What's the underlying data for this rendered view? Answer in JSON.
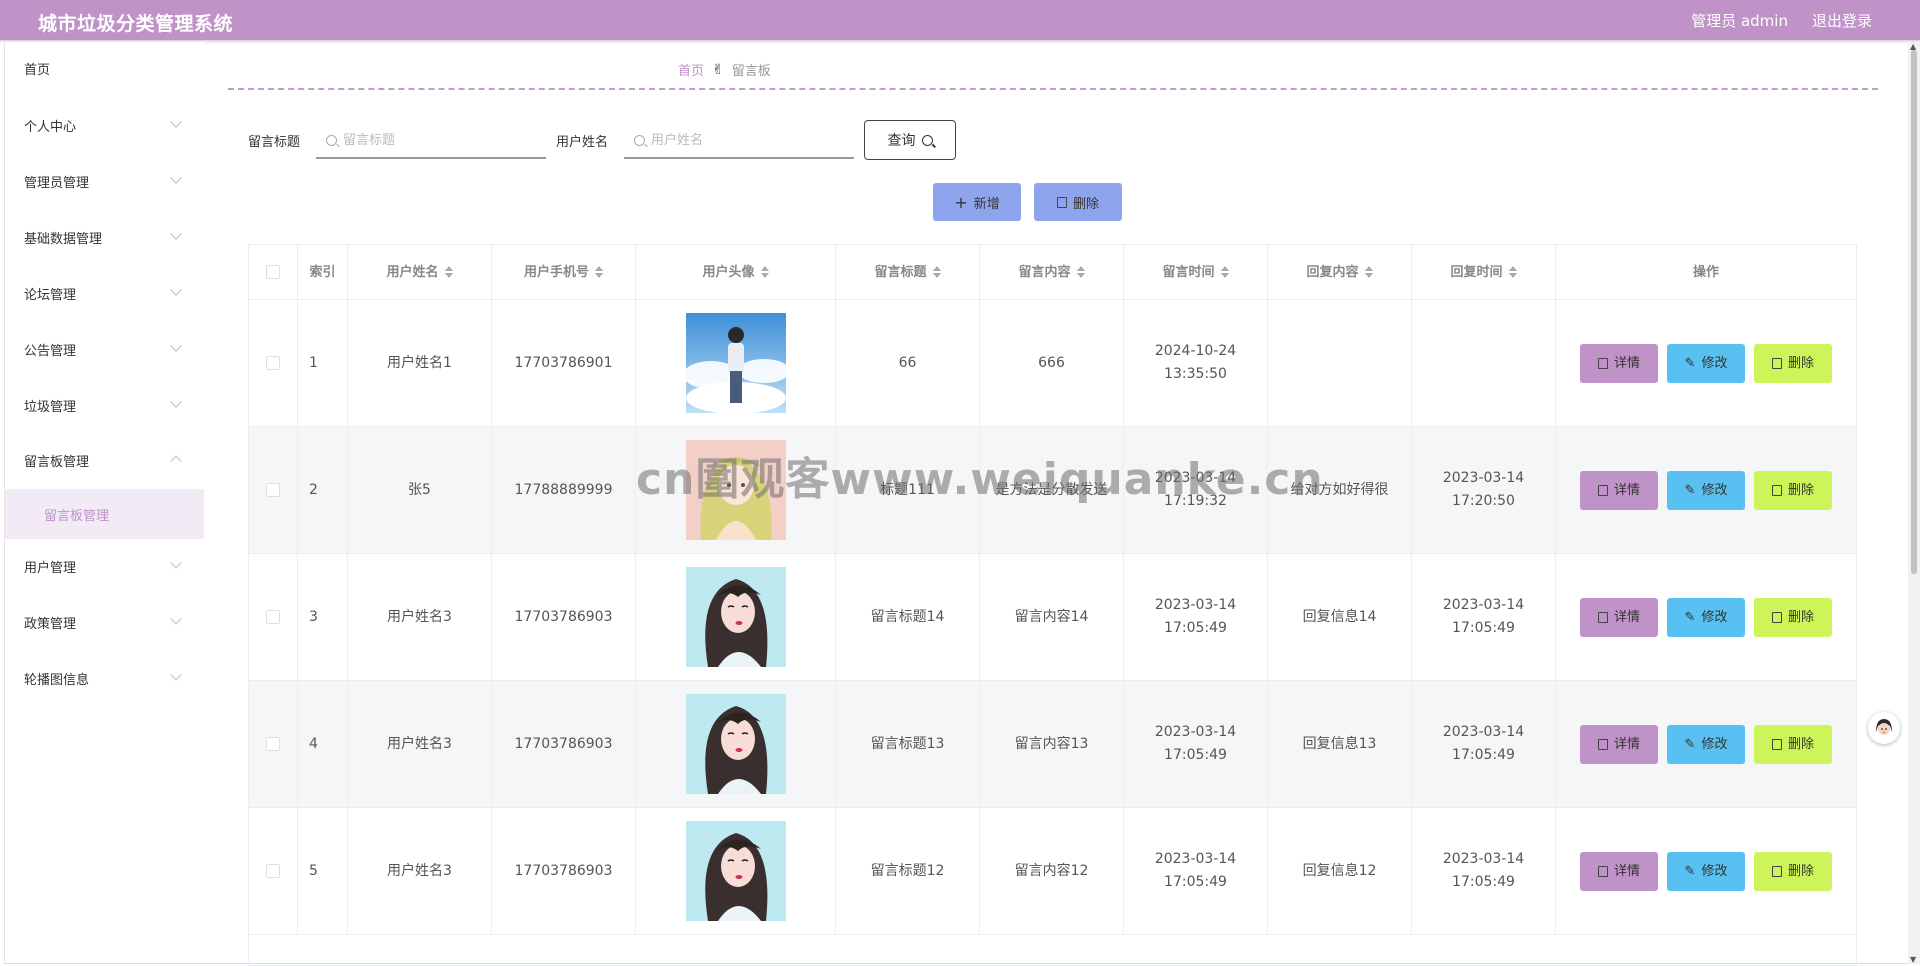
{
  "header": {
    "app_title": "城市垃圾分类管理系统",
    "user_label": "管理员 admin",
    "logout_label": "退出登录",
    "bg_color": "#bf93c8"
  },
  "sidebar": {
    "items": [
      {
        "label": "首页",
        "has_chevron": false
      },
      {
        "label": "个人中心",
        "has_chevron": true
      },
      {
        "label": "管理员管理",
        "has_chevron": true
      },
      {
        "label": "基础数据管理",
        "has_chevron": true
      },
      {
        "label": "论坛管理",
        "has_chevron": true
      },
      {
        "label": "公告管理",
        "has_chevron": true
      },
      {
        "label": "垃圾管理",
        "has_chevron": true
      },
      {
        "label": "留言板管理",
        "has_chevron": true,
        "expanded": true
      },
      {
        "label": "用户管理",
        "has_chevron": true
      },
      {
        "label": "政策管理",
        "has_chevron": true
      },
      {
        "label": "轮播图信息",
        "has_chevron": true
      }
    ],
    "active_subitem": "留言板管理"
  },
  "breadcrumb": {
    "home": "首页",
    "separator_icon": "hand-icon",
    "current": "留言板"
  },
  "search": {
    "title_label": "留言标题",
    "title_placeholder": "留言标题",
    "title_value": "",
    "name_label": "用户姓名",
    "name_placeholder": "用户姓名",
    "name_value": "",
    "query_label": "查询"
  },
  "actions": {
    "add_label": "新增",
    "delete_label": "删除"
  },
  "table": {
    "columns": [
      "索引",
      "用户姓名",
      "用户手机号",
      "用户头像",
      "留言标题",
      "留言内容",
      "留言时间",
      "回复内容",
      "回复时间",
      "操作"
    ],
    "rows": [
      {
        "index": "1",
        "name": "用户姓名1",
        "phone": "17703786901",
        "avatar": "boy-sky",
        "title": "66",
        "content": "666",
        "time": "2024-10-24 13:35:50",
        "reply": "",
        "reply_time": ""
      },
      {
        "index": "2",
        "name": "张5",
        "phone": "17788889999",
        "avatar": "anime-girl",
        "title": "标题111",
        "content": "是方法是分散发送",
        "time": "2023-03-14 17:19:32",
        "reply": "给对方如好得很",
        "reply_time": "2023-03-14 17:20:50"
      },
      {
        "index": "3",
        "name": "用户姓名3",
        "phone": "17703786903",
        "avatar": "girl-portrait",
        "title": "留言标题14",
        "content": "留言内容14",
        "time": "2023-03-14 17:05:49",
        "reply": "回复信息14",
        "reply_time": "2023-03-14 17:05:49"
      },
      {
        "index": "4",
        "name": "用户姓名3",
        "phone": "17703786903",
        "avatar": "girl-portrait",
        "title": "留言标题13",
        "content": "留言内容13",
        "time": "2023-03-14 17:05:49",
        "reply": "回复信息13",
        "reply_time": "2023-03-14 17:05:49"
      },
      {
        "index": "5",
        "name": "用户姓名3",
        "phone": "17703786903",
        "avatar": "girl-portrait",
        "title": "留言标题12",
        "content": "留言内容12",
        "time": "2023-03-14 17:05:49",
        "reply": "回复信息12",
        "reply_time": "2023-03-14 17:05:49"
      }
    ],
    "ops": {
      "detail": "详情",
      "edit": "修改",
      "delete": "删除"
    }
  },
  "watermark": "cn圍观客www.weiquanke.cn",
  "colors": {
    "accent": "#bf93c8",
    "add_btn": "#8ea4ec",
    "edit_btn": "#58c1f1",
    "delete_btn": "#cdf55a"
  }
}
